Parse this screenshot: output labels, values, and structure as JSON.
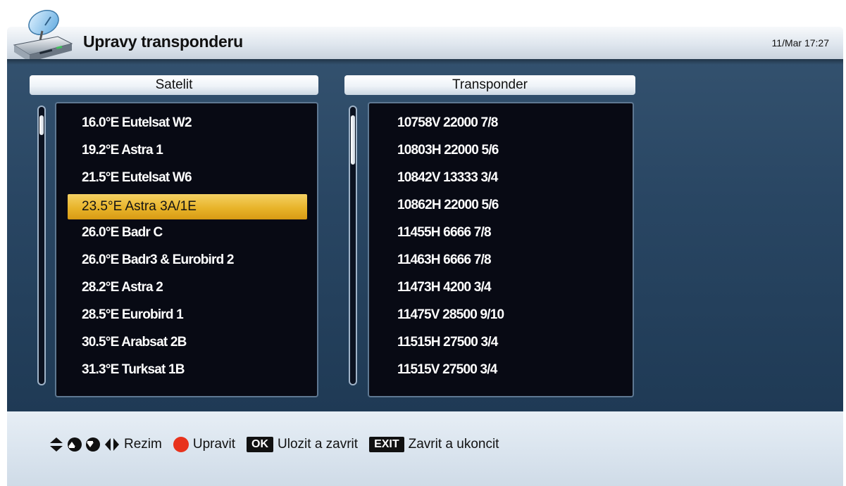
{
  "header": {
    "title": "Upravy transponderu",
    "datetime": "11/Mar 17:27"
  },
  "satellite_panel": {
    "header": "Satelit",
    "selected_index": 3,
    "items": [
      "16.0°E Eutelsat W2",
      "19.2°E Astra 1",
      "21.5°E Eutelsat W6",
      "23.5°E Astra 3A/1E",
      "26.0°E Badr C",
      "26.0°E Badr3 & Eurobird 2",
      "28.2°E Astra 2",
      "28.5°E Eurobird 1",
      "30.5°E Arabsat 2B",
      "31.3°E Turksat 1B"
    ]
  },
  "transponder_panel": {
    "header": "Transponder",
    "items": [
      "10758V 22000 7/8",
      "10803H 22000 5/6",
      "10842V 13333 3/4",
      "10862H 22000 5/6",
      "11455H 6666 7/8",
      "11463H 6666 7/8",
      "11473H 4200 3/4",
      "11475V 28500 9/10",
      "11515H 27500 3/4",
      "11515V 27500 3/4"
    ]
  },
  "footer": {
    "mode_label": "Rezim",
    "edit_label": "Upravit",
    "ok_key": "OK",
    "ok_label": "Ulozit a zavrit",
    "exit_key": "EXIT",
    "exit_label": "Zavrit a ukoncit"
  },
  "colors": {
    "highlight": "#e8b42a",
    "panel_bg": "#294663",
    "list_bg": "#080a14",
    "red_button": "#e8321c"
  },
  "icons": [
    "satellite-receiver-icon",
    "up-down-arrow-icon",
    "page-up-icon",
    "page-down-icon",
    "left-right-arrow-icon",
    "red-button-icon"
  ]
}
